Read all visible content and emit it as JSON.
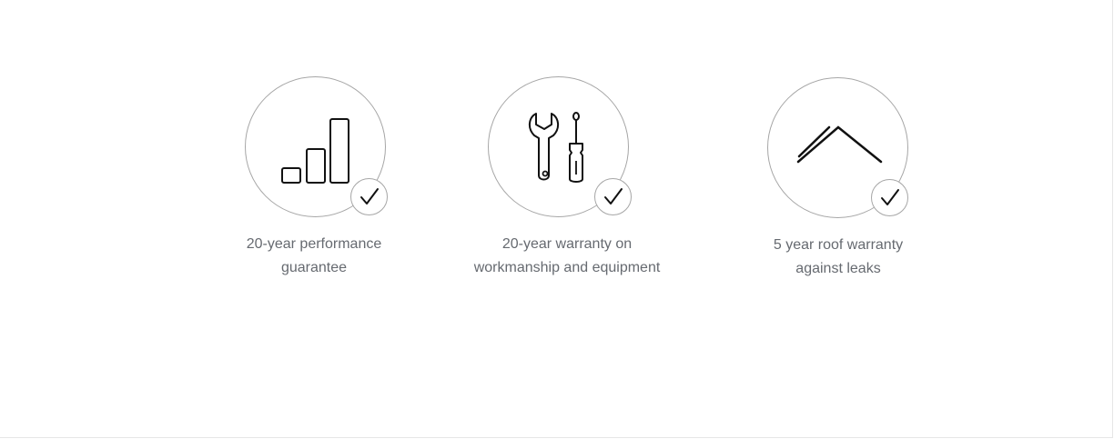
{
  "features": [
    {
      "icon": "signal-bars-icon",
      "caption_line1": "20-year performance",
      "caption_line2": "guarantee",
      "check_icon": "checkmark-icon"
    },
    {
      "icon": "wrench-screwdriver-icon",
      "caption_line1": "20-year warranty on",
      "caption_line2": "workmanship and equipment",
      "check_icon": "checkmark-icon"
    },
    {
      "icon": "roof-icon",
      "caption_line1": "5 year roof warranty",
      "caption_line2": "against leaks",
      "check_icon": "checkmark-icon"
    }
  ],
  "colors": {
    "circle_border": "#a6a6a6",
    "icon_stroke": "#111111",
    "caption_text": "#666a70"
  }
}
